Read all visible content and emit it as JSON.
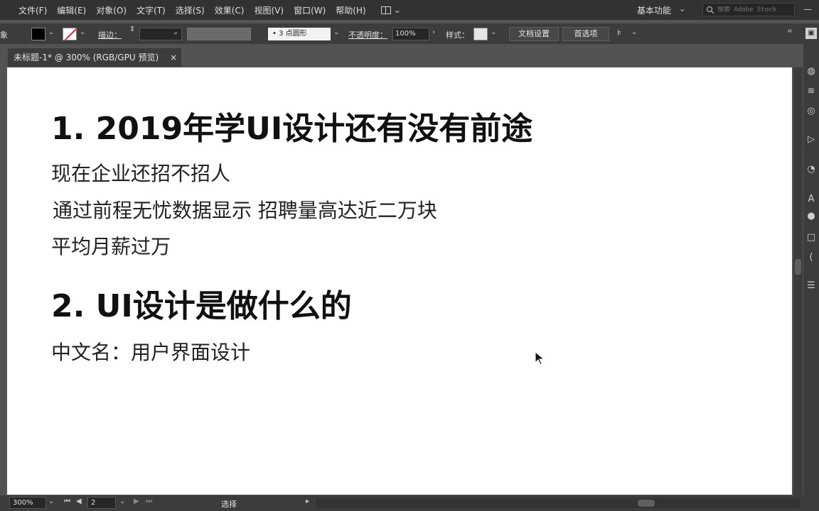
{
  "menu": {
    "items": [
      "文件(F)",
      "编辑(E)",
      "对象(O)",
      "文字(T)",
      "选择(S)",
      "效果(C)",
      "视图(V)",
      "窗口(W)",
      "帮助(H)"
    ],
    "workspace": "基本功能",
    "stock_search_placeholder": "搜索 Adobe Stock"
  },
  "control": {
    "left_label": "象",
    "stroke_label": "描边：",
    "brush_value": "3 点圆形",
    "opacity_label": "不透明度：",
    "opacity_value": "100%",
    "style_label": "样式：",
    "doc_setup_label": "文档设置",
    "prefs_label": "首选项"
  },
  "document_tab": {
    "title": "未标题-1* @ 300% (RGB/GPU 预览)",
    "close": "×"
  },
  "artboard": {
    "heading1": "1. 2019年学UI设计还有没有前途",
    "line1": "现在企业还招不招人",
    "line2": "通过前程无忧数据显示 招聘量高达近二万块",
    "line3": "平均月薪过万",
    "heading2": "2. UI设计是做什么的",
    "line4": "中文名：用户界面设计"
  },
  "status": {
    "zoom": "300%",
    "artboard_number": "2",
    "tool": "选择"
  }
}
